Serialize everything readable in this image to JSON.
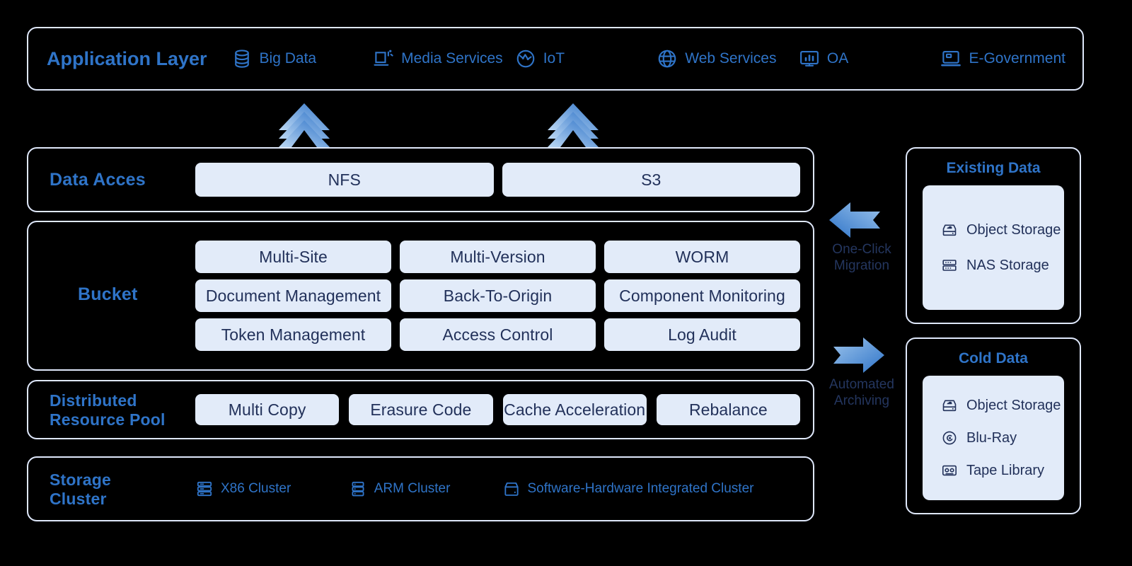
{
  "colors": {
    "background": "#000000",
    "accent_blue": "#2f74c8",
    "chip_fill": "#e2ebf9",
    "chip_text": "#22315a",
    "panel_border": "#dfe8fb",
    "arrow_light": "#9cc4ec",
    "arrow_dark": "#2f74c8"
  },
  "application_layer": {
    "title": "Application Layer",
    "items": [
      {
        "label": "Big Data",
        "icon": "database-icon"
      },
      {
        "label": "Media Services",
        "icon": "media-screen-icon"
      },
      {
        "label": "IoT",
        "icon": "iot-globe-icon"
      },
      {
        "label": "Web Services",
        "icon": "globe-icon"
      },
      {
        "label": "OA",
        "icon": "monitor-chart-icon"
      },
      {
        "label": "E-Government",
        "icon": "laptop-icon"
      }
    ]
  },
  "up_arrows": [
    {
      "name": "up-arrow-nfs",
      "icon": "triple-chevron-up-icon"
    },
    {
      "name": "up-arrow-s3",
      "icon": "triple-chevron-up-icon"
    }
  ],
  "data_access": {
    "label": "Data Acces",
    "chips": [
      "NFS",
      "S3"
    ]
  },
  "bucket": {
    "label": "Bucket",
    "chips": [
      "Multi-Site",
      "Multi-Version",
      "WORM",
      "Document Management",
      "Back-To-Origin",
      "Component Monitoring",
      "Token Management",
      "Access Control",
      "Log Audit"
    ]
  },
  "distributed_resource_pool": {
    "label": "Distributed\nResource Pool",
    "chips": [
      "Multi Copy",
      "Erasure Code",
      "Cache Acceleration",
      "Rebalance"
    ]
  },
  "storage_cluster": {
    "label": "Storage\nCluster",
    "items": [
      {
        "label": "X86 Cluster",
        "icon": "server-stack-icon"
      },
      {
        "label": "ARM Cluster",
        "icon": "server-rack-icon"
      },
      {
        "label": "Software-Hardware Integrated Cluster",
        "icon": "appliance-icon"
      }
    ]
  },
  "migration": {
    "arrow": "arrow-left-icon",
    "caption": "One-Click\nMigration"
  },
  "archiving": {
    "arrow": "arrow-right-icon",
    "caption": "Automated\nArchiving"
  },
  "existing_data": {
    "title": "Existing Data",
    "items": [
      {
        "label": "Object Storage",
        "icon": "object-storage-icon"
      },
      {
        "label": "NAS Storage",
        "icon": "nas-storage-icon"
      }
    ]
  },
  "cold_data": {
    "title": "Cold Data",
    "items": [
      {
        "label": "Object Storage",
        "icon": "object-storage-icon"
      },
      {
        "label": "Blu-Ray",
        "icon": "disc-icon"
      },
      {
        "label": "Tape Library",
        "icon": "tape-icon"
      }
    ]
  }
}
